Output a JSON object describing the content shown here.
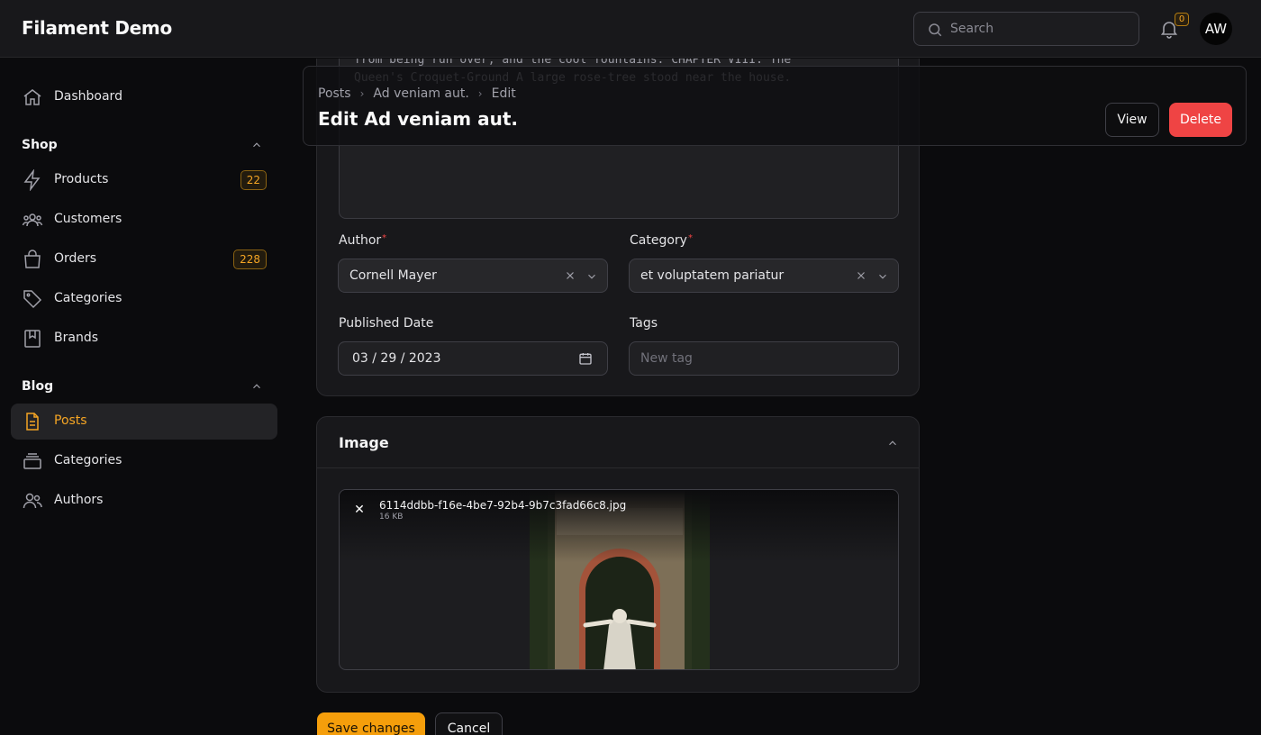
{
  "app": {
    "brand": "Filament Demo"
  },
  "topbar": {
    "search_placeholder": "Search",
    "notifications_count": "0",
    "avatar_initials": "AW"
  },
  "sidebar": {
    "dashboard": "Dashboard",
    "shop_group": "Shop",
    "shop_items": [
      {
        "label": "Products",
        "badge": "22"
      },
      {
        "label": "Customers"
      },
      {
        "label": "Orders",
        "badge": "228"
      },
      {
        "label": "Categories"
      },
      {
        "label": "Brands"
      }
    ],
    "blog_group": "Blog",
    "blog_items": [
      {
        "label": "Posts"
      },
      {
        "label": "Categories"
      },
      {
        "label": "Authors"
      }
    ]
  },
  "header": {
    "breadcrumbs": [
      "Posts",
      "Ad veniam aut.",
      "Edit"
    ],
    "title": "Edit Ad veniam aut.",
    "view_label": "View",
    "delete_label": "Delete"
  },
  "form": {
    "content_text": "Alice ... by the ... bright ... and those cool fountains ... \nfrom being run over; and the cool fountains. CHAPTER VIII. The\nQueen's Croquet-Ground A large rose-tree stood near the house.",
    "author_label": "Author",
    "author_value": "Cornell Mayer",
    "category_label": "Category",
    "category_value": "et voluptatem pariatur",
    "published_label": "Published Date",
    "published_value": "03 / 29 / 2023",
    "tags_label": "Tags",
    "tags_placeholder": "New tag"
  },
  "image_section": {
    "title": "Image",
    "file_name": "6114ddbb-f16e-4be7-92b4-9b7c3fad66c8.jpg",
    "file_size": "16 KB"
  },
  "actions": {
    "save_label": "Save changes",
    "cancel_label": "Cancel"
  },
  "colors": {
    "accent": "#f59e0b",
    "danger": "#ef4444",
    "background": "#0b0b0d",
    "surface": "#18181b"
  }
}
